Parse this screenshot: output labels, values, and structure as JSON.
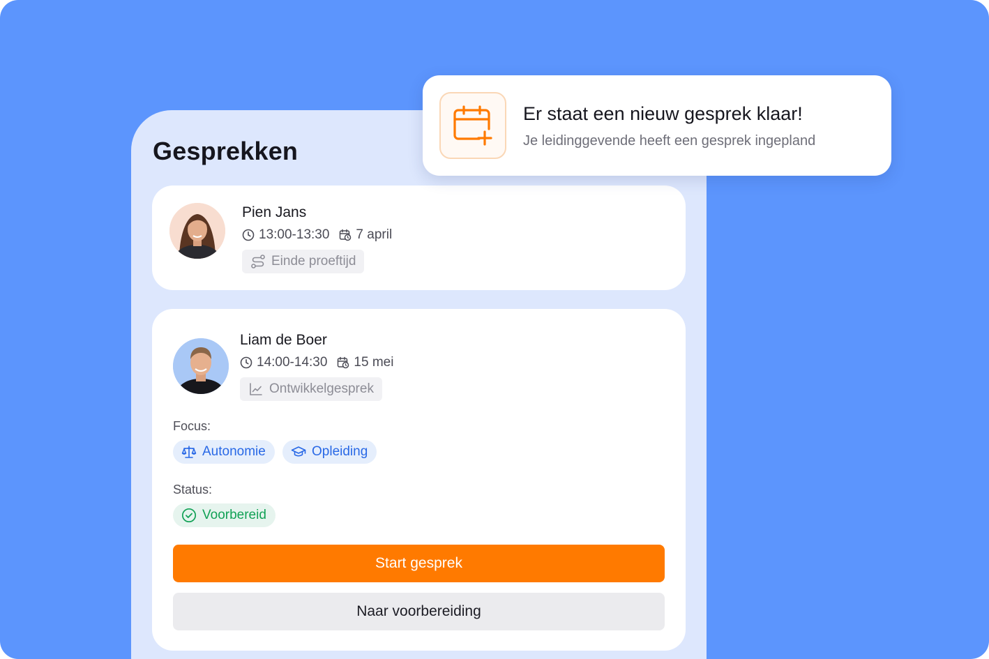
{
  "page": {
    "title": "Gesprekken"
  },
  "notification": {
    "title": "Er staat een nieuw gesprek klaar!",
    "subtitle": "Je leidinggevende heeft een gesprek ingepland",
    "icon": "calendar-plus-icon"
  },
  "meetings": [
    {
      "name": "Pien Jans",
      "time": "13:00-13:30",
      "date": "7 april",
      "type": "Einde proeftijd",
      "type_icon": "route-icon"
    },
    {
      "name": "Liam de Boer",
      "time": "14:00-14:30",
      "date": "15 mei",
      "type": "Ontwikkelgesprek",
      "type_icon": "line-chart-icon",
      "focus_label": "Focus:",
      "focus": [
        {
          "label": "Autonomie",
          "icon": "scale-icon"
        },
        {
          "label": "Opleiding",
          "icon": "graduation-cap-icon"
        }
      ],
      "status_label": "Status:",
      "status": {
        "label": "Voorbereid",
        "icon": "check-circle-icon"
      },
      "primary_action": "Start gesprek",
      "secondary_action": "Naar voorbereiding"
    }
  ],
  "colors": {
    "background": "#5c95fd",
    "panel": "#dde7fd",
    "accent": "#ff7a00",
    "chip_blue": "#2868e6",
    "chip_green": "#11a155"
  }
}
